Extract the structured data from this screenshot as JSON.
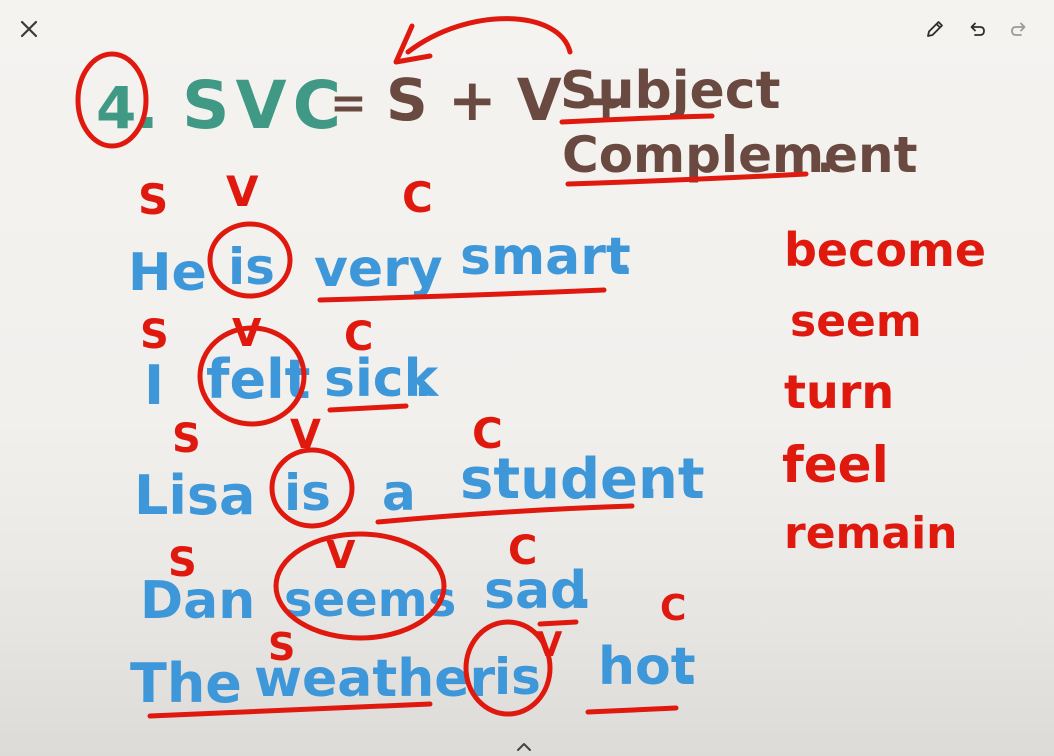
{
  "toolbar": {
    "close_icon": "close-icon",
    "pen_icon": "pencil-icon",
    "undo_icon": "undo-icon",
    "redo_icon": "redo-icon"
  },
  "heading": {
    "number": "4.",
    "pattern": "SVC",
    "equals": "=",
    "formula": "S + V +",
    "subject": "Subject",
    "complement": "Complement",
    "period": "."
  },
  "sentences": [
    {
      "labels": [
        "S",
        "V",
        "C"
      ],
      "words": [
        "He",
        "is",
        "very",
        "smart",
        "."
      ]
    },
    {
      "labels": [
        "S",
        "V",
        "C"
      ],
      "words": [
        "I",
        "felt",
        "sick",
        "."
      ]
    },
    {
      "labels": [
        "S",
        "V",
        "C"
      ],
      "words": [
        "Lisa",
        "is",
        "a",
        "student",
        "."
      ]
    },
    {
      "labels": [
        "S",
        "V",
        "C"
      ],
      "words": [
        "Dan",
        "seems",
        "sad",
        "."
      ]
    },
    {
      "labels": [
        "S",
        "V",
        "C"
      ],
      "words": [
        "The",
        "weather",
        "is",
        "hot",
        "."
      ]
    }
  ],
  "verb_list": [
    "become",
    "seem",
    "turn",
    "feel",
    "remain"
  ],
  "colors": {
    "blue_ink": "#3d97d8",
    "teal_ink": "#3f9985",
    "brown_ink": "#6a4a40",
    "red_ink": "#e0190f",
    "background": "#f5f3f0"
  },
  "bottom_handle_icon": "chevron-up-icon"
}
